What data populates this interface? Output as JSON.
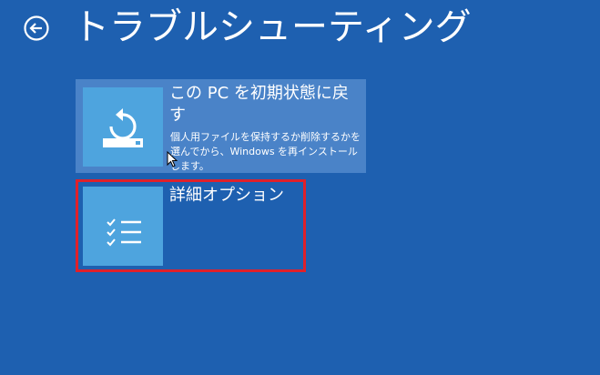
{
  "header": {
    "title": "トラブルシューティング",
    "back_icon": "back-arrow-icon"
  },
  "tiles": [
    {
      "title": "この PC を初期状態に戻す",
      "description": "個人用ファイルを保持するか削除するかを選んでから、Windows を再インストールします。",
      "icon": "reset-icon"
    },
    {
      "title": "詳細オプション",
      "icon": "checklist-icon",
      "highlighted": true
    }
  ],
  "colors": {
    "background": "#1e60b0",
    "tile_bg": "#4a83c8",
    "icon_bg": "#4ea4de",
    "highlight": "#e0202a"
  }
}
